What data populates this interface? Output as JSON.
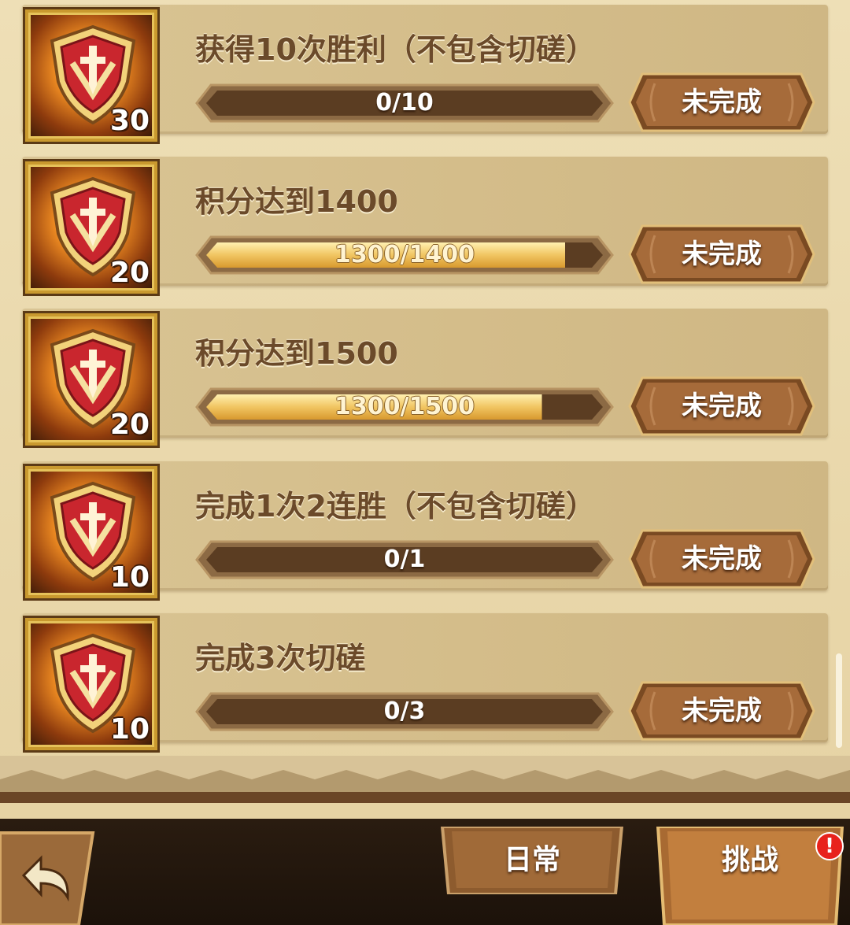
{
  "tasks": [
    {
      "title": "获得10次胜利（不包含切磋）",
      "reward": "30",
      "progress_label": "0/10",
      "progress": 0.0,
      "status": "未完成"
    },
    {
      "title": "积分达到1400",
      "reward": "20",
      "progress_label": "1300/1400",
      "progress": 0.9286,
      "status": "未完成"
    },
    {
      "title": "积分达到1500",
      "reward": "20",
      "progress_label": "1300/1500",
      "progress": 0.8667,
      "status": "未完成"
    },
    {
      "title": "完成1次2连胜（不包含切磋）",
      "reward": "10",
      "progress_label": "0/1",
      "progress": 0.0,
      "status": "未完成"
    },
    {
      "title": "完成3次切磋",
      "reward": "10",
      "progress_label": "0/3",
      "progress": 0.0,
      "status": "未完成"
    }
  ],
  "tabs": {
    "daily": "日常",
    "challenge": "挑战"
  },
  "alert_badge": "!",
  "icons": {
    "reward": "shield-sword-icon",
    "back": "back-arrow-icon"
  },
  "colors": {
    "accent_gold": "#f0c255",
    "bar_track": "#5b3d22",
    "button_bg": "#9c6433",
    "badge_red": "#e8221c"
  }
}
